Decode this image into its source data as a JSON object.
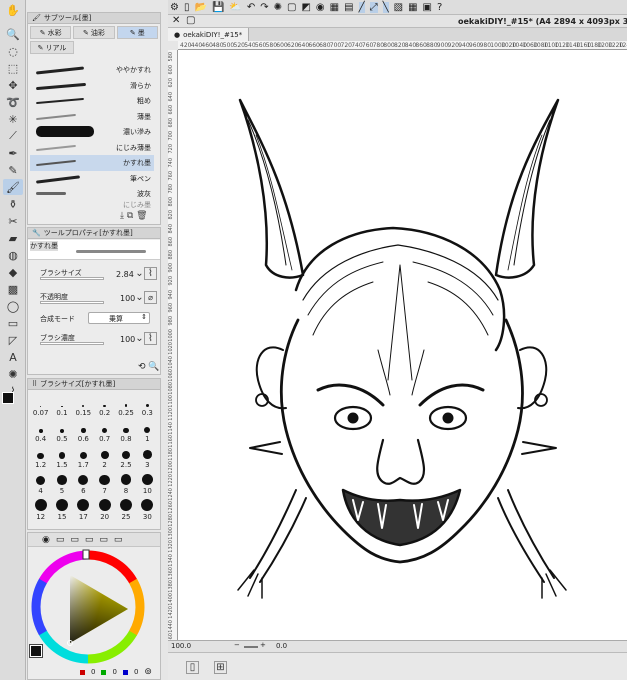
{
  "subtool_panel": {
    "title": "サブツール[墨]",
    "tabs": [
      {
        "label": "水彩",
        "selected": false
      },
      {
        "label": "油彩",
        "selected": false
      },
      {
        "label": "墨",
        "selected": true
      }
    ],
    "tab2": "リアル",
    "brushes": [
      {
        "label": "ややかすれ",
        "selected": false
      },
      {
        "label": "滑らか",
        "selected": false
      },
      {
        "label": "粗め",
        "selected": false
      },
      {
        "label": "薄墨",
        "selected": false
      },
      {
        "label": "濃い滲み",
        "selected": false
      },
      {
        "label": "にじみ薄墨",
        "selected": false
      },
      {
        "label": "かすれ墨",
        "selected": true
      },
      {
        "label": "筆ペン",
        "selected": false
      },
      {
        "label": "波灰",
        "selected": false
      }
    ],
    "brush_partial": "にじみ墨"
  },
  "tool_property": {
    "title": "ツールプロパティ[かすれ墨]",
    "preview_label": "かすれ墨",
    "brush_size_label": "ブラシサイズ",
    "brush_size_value": "2.84",
    "opacity_label": "不透明度",
    "opacity_value": "100",
    "blend_label": "合成モード",
    "blend_value": "乗算",
    "density_label": "ブラシ濃度",
    "density_value": "100"
  },
  "brush_size_panel": {
    "title": "ブラシサイズ[かすれ墨]",
    "sizes": [
      "0.07",
      "0.1",
      "0.15",
      "0.2",
      "0.25",
      "0.3",
      "0.4",
      "0.5",
      "0.6",
      "0.7",
      "0.8",
      "1",
      "1.2",
      "1.5",
      "1.7",
      "2",
      "2.5",
      "3",
      "4",
      "5",
      "6",
      "7",
      "8",
      "10",
      "12",
      "15",
      "17",
      "20",
      "25",
      "30"
    ]
  },
  "color": {
    "main": "#111111",
    "sub": "#ffffff",
    "values": [
      "0",
      "0",
      "0"
    ]
  },
  "document": {
    "tab_title": "oekakiDIY!_#15*",
    "window_title": "oekakiDIY!_#15* (A4 2894 x 4093px 350",
    "zoom": "100.0",
    "rotation": "0.0"
  },
  "rulers": {
    "h": [
      "420",
      "440",
      "460",
      "480",
      "500",
      "520",
      "540",
      "560",
      "580",
      "600",
      "620",
      "640",
      "660",
      "680",
      "700",
      "720",
      "740",
      "760",
      "780",
      "800",
      "820",
      "840",
      "860",
      "880",
      "900",
      "920",
      "940",
      "960",
      "980",
      "1000",
      "1020",
      "1040",
      "1060",
      "1080",
      "1100",
      "1120",
      "1140",
      "1160",
      "1180",
      "1200",
      "1220",
      "1240"
    ],
    "v": [
      "580",
      "600",
      "620",
      "640",
      "660",
      "680",
      "700",
      "720",
      "740",
      "760",
      "780",
      "800",
      "820",
      "840",
      "860",
      "880",
      "900",
      "920",
      "940",
      "960",
      "980",
      "1000",
      "1020",
      "1040",
      "1060",
      "1080",
      "1100",
      "1120",
      "1140",
      "1160",
      "1180",
      "1200",
      "1220",
      "1240",
      "1260",
      "1280",
      "1300",
      "1320",
      "1340",
      "1360",
      "1380",
      "1400",
      "1420",
      "1440",
      "1460"
    ]
  }
}
